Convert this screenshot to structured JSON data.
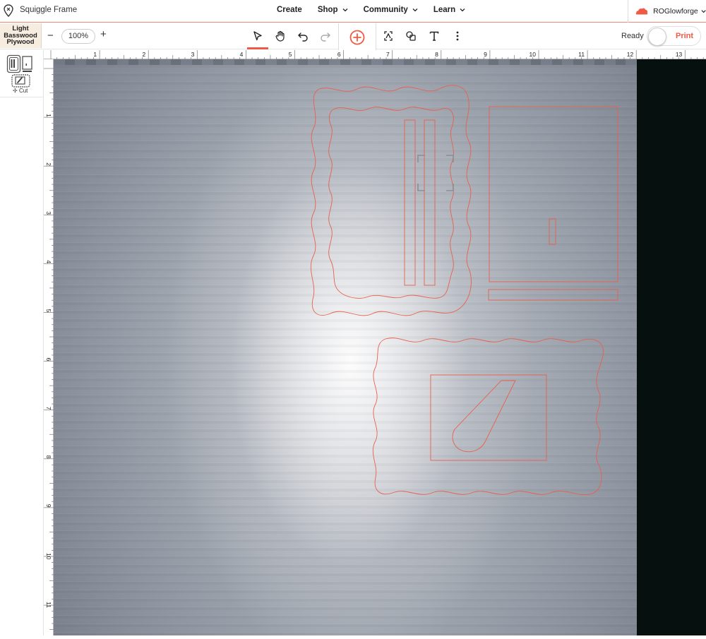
{
  "app": {
    "document_title": "Squiggle Frame"
  },
  "nav": {
    "items": [
      {
        "label": "Create",
        "has_menu": false
      },
      {
        "label": "Shop",
        "has_menu": true
      },
      {
        "label": "Community",
        "has_menu": true
      },
      {
        "label": "Learn",
        "has_menu": true
      }
    ]
  },
  "account": {
    "name": "ROGlowforge",
    "icon": "cloud-logo-icon"
  },
  "toolbar": {
    "material": {
      "line1": "Light",
      "line2": "Basswood",
      "line3": "Plywood"
    },
    "zoom_minus": "−",
    "zoom_value": "100%",
    "zoom_plus": "+",
    "tools": [
      "select-arrow-icon",
      "pan-hand-icon",
      "undo-icon",
      "redo-icon",
      "add-circle-icon",
      "trace-icon",
      "shapes-icon",
      "text-icon",
      "more-vertical-icon"
    ],
    "status": "Ready",
    "print_label": "Print"
  },
  "sidebar": {
    "operation_label": "Cut"
  },
  "rulers": {
    "top": [
      "1",
      "2",
      "3",
      "4",
      "5",
      "6",
      "7",
      "8",
      "9",
      "10",
      "11",
      "12",
      "13"
    ],
    "left": [
      "1",
      "2",
      "3",
      "4",
      "5",
      "6",
      "7",
      "8",
      "9",
      "10",
      "11"
    ]
  },
  "colors": {
    "accent": "#f05a44",
    "cut_line": "#e8604c",
    "material_bg": "#f6ecdf",
    "camera_edge": "#06100f"
  }
}
